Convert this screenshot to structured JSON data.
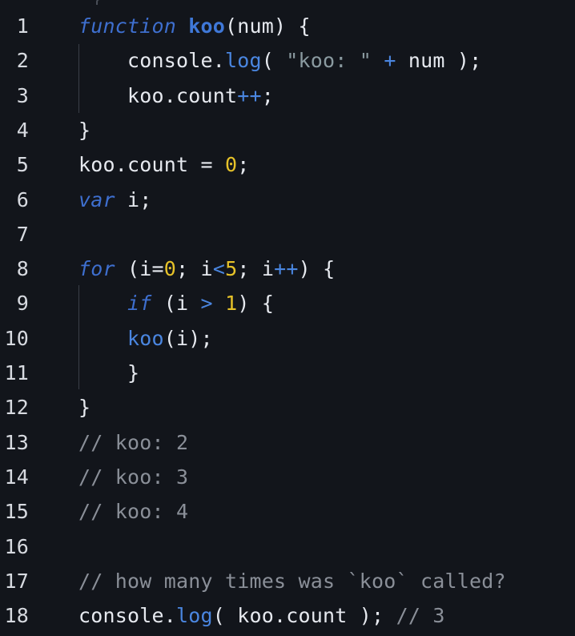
{
  "editor": {
    "top_fragment": "_ }",
    "lines": [
      {
        "number": "1",
        "tokens": [
          {
            "t": "function",
            "c": "kw"
          },
          {
            "t": " ",
            "c": "plain"
          },
          {
            "t": "koo",
            "c": "fn"
          },
          {
            "t": "(num) {",
            "c": "plain"
          }
        ]
      },
      {
        "number": "2",
        "tokens": [
          {
            "t": "    console.",
            "c": "plain"
          },
          {
            "t": "log",
            "c": "method"
          },
          {
            "t": "( ",
            "c": "plain"
          },
          {
            "t": "\"koo: \"",
            "c": "str"
          },
          {
            "t": " ",
            "c": "plain"
          },
          {
            "t": "+",
            "c": "op"
          },
          {
            "t": " num );",
            "c": "plain"
          }
        ]
      },
      {
        "number": "3",
        "tokens": [
          {
            "t": "    koo.count",
            "c": "plain"
          },
          {
            "t": "++",
            "c": "op"
          },
          {
            "t": ";",
            "c": "plain"
          }
        ]
      },
      {
        "number": "4",
        "tokens": [
          {
            "t": "}",
            "c": "plain"
          }
        ]
      },
      {
        "number": "5",
        "tokens": [
          {
            "t": "koo.count = ",
            "c": "plain"
          },
          {
            "t": "0",
            "c": "num"
          },
          {
            "t": ";",
            "c": "plain"
          }
        ]
      },
      {
        "number": "6",
        "tokens": [
          {
            "t": "var",
            "c": "kw"
          },
          {
            "t": " i;",
            "c": "plain"
          }
        ]
      },
      {
        "number": "7",
        "tokens": []
      },
      {
        "number": "8",
        "tokens": [
          {
            "t": "for",
            "c": "kw"
          },
          {
            "t": " (i=",
            "c": "plain"
          },
          {
            "t": "0",
            "c": "num"
          },
          {
            "t": "; i",
            "c": "plain"
          },
          {
            "t": "<",
            "c": "op"
          },
          {
            "t": "5",
            "c": "num"
          },
          {
            "t": "; i",
            "c": "plain"
          },
          {
            "t": "++",
            "c": "op"
          },
          {
            "t": ") {",
            "c": "plain"
          }
        ]
      },
      {
        "number": "9",
        "tokens": [
          {
            "t": "    ",
            "c": "plain"
          },
          {
            "t": "if",
            "c": "kw"
          },
          {
            "t": " (i ",
            "c": "plain"
          },
          {
            "t": ">",
            "c": "op"
          },
          {
            "t": " ",
            "c": "plain"
          },
          {
            "t": "1",
            "c": "num"
          },
          {
            "t": ") {",
            "c": "plain"
          }
        ]
      },
      {
        "number": "10",
        "tokens": [
          {
            "t": "    ",
            "c": "plain"
          },
          {
            "t": "koo",
            "c": "method"
          },
          {
            "t": "(i);",
            "c": "plain"
          }
        ]
      },
      {
        "number": "11",
        "tokens": [
          {
            "t": "    }",
            "c": "plain"
          }
        ]
      },
      {
        "number": "12",
        "tokens": [
          {
            "t": "}",
            "c": "plain"
          }
        ]
      },
      {
        "number": "13",
        "tokens": [
          {
            "t": "// koo: 2",
            "c": "com"
          }
        ]
      },
      {
        "number": "14",
        "tokens": [
          {
            "t": "// koo: 3",
            "c": "com"
          }
        ]
      },
      {
        "number": "15",
        "tokens": [
          {
            "t": "// koo: 4",
            "c": "com"
          }
        ]
      },
      {
        "number": "16",
        "tokens": []
      },
      {
        "number": "17",
        "tokens": [
          {
            "t": "// how many times was `koo` called?",
            "c": "com"
          }
        ]
      },
      {
        "number": "18",
        "tokens": [
          {
            "t": "console.",
            "c": "plain"
          },
          {
            "t": "log",
            "c": "method"
          },
          {
            "t": "( koo.count ); ",
            "c": "plain"
          },
          {
            "t": "// 3",
            "c": "com"
          }
        ]
      }
    ]
  },
  "colors": {
    "background": "#12151b",
    "keyword": "#3e6fcf",
    "function_name": "#3f78d8",
    "number": "#e6c229",
    "string": "#8a9aa0",
    "comment": "#8a8f98",
    "text": "#e6e9ef"
  }
}
